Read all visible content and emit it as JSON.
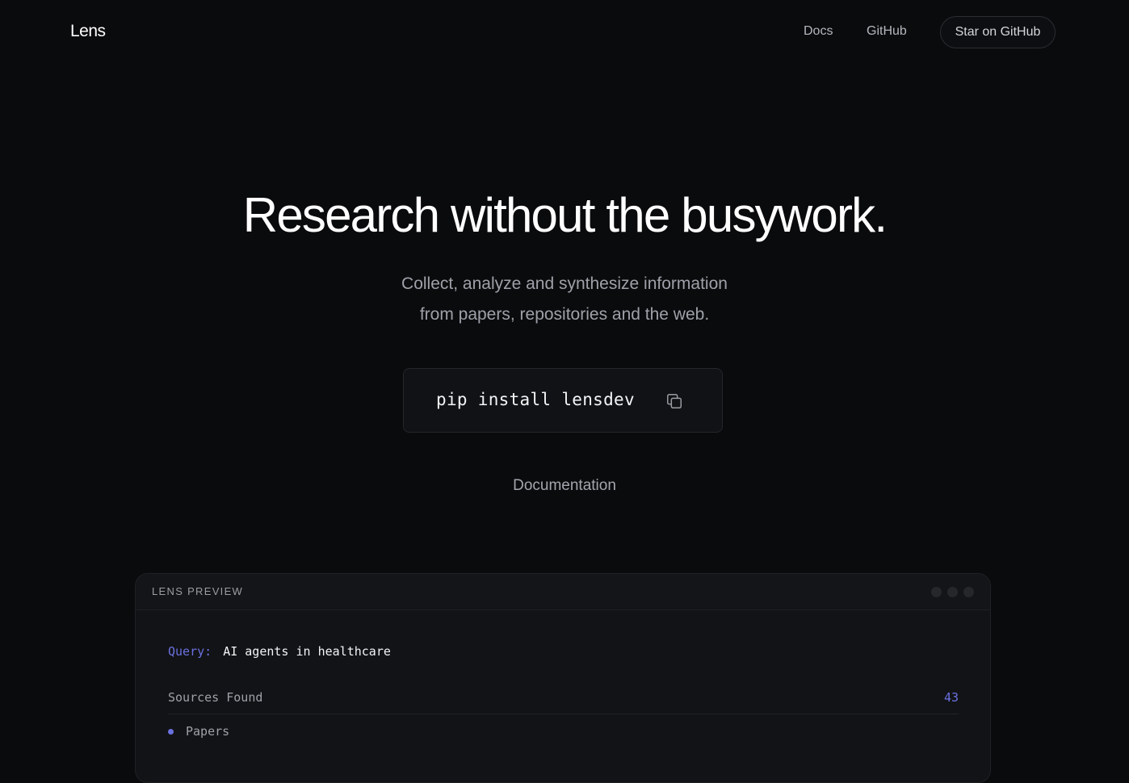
{
  "nav": {
    "logo": "Lens",
    "links": [
      {
        "label": "Docs"
      },
      {
        "label": "GitHub"
      }
    ],
    "star_button": "Star on GitHub"
  },
  "hero": {
    "title": "Research without the busywork.",
    "subtitle_line1": "Collect, analyze and synthesize information",
    "subtitle_line2": "from papers, repositories and the web.",
    "install_command": "pip install lensdev",
    "copy_icon": "copy-icon",
    "docs_link": "Documentation"
  },
  "preview": {
    "label": "LENS PREVIEW",
    "query_label": "Query:",
    "query_value": "AI agents in healthcare",
    "sources_label": "Sources Found",
    "sources_count": "43",
    "papers_label": "Papers"
  },
  "colors": {
    "accent": "#6b71e0",
    "background": "#0a0b0d"
  }
}
